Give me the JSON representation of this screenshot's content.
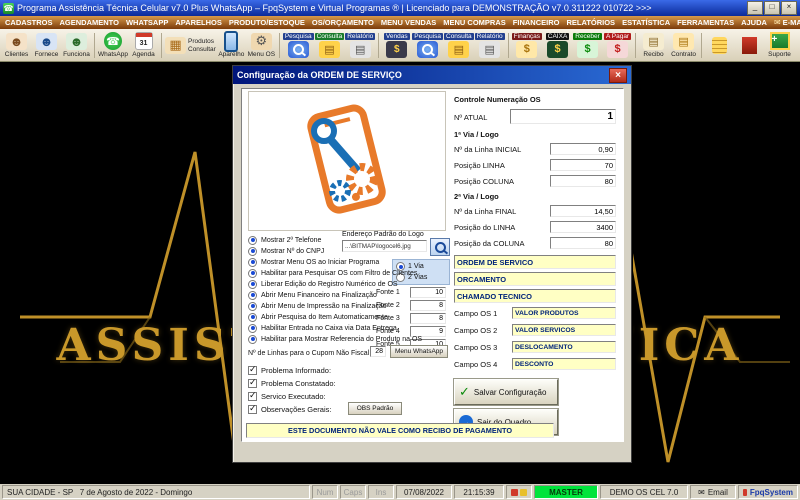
{
  "titlebar": {
    "title": "Programa Assistência Técnica Celular v7.0 Plus WhatsApp – FpqSystem e Virtual Programas ® | Licenciado para  DEMONSTRAÇÃO v7.0.311222 010722 >>>"
  },
  "menubar": {
    "items": [
      "CADASTROS",
      "AGENDAMENTO",
      "WHATSAPP",
      "APARELHOS",
      "PRODUTO/ESTOQUE",
      "OS/ORÇAMENTO",
      "MENU VENDAS",
      "MENU COMPRAS",
      "FINANCEIRO",
      "RELATÓRIOS",
      "ESTATÍSTICA",
      "FERRAMENTAS",
      "AJUDA",
      "E-MAIL"
    ]
  },
  "toolbar": {
    "items": [
      {
        "label": "Clientes"
      },
      {
        "label": "Fornece"
      },
      {
        "label": "Funciona"
      },
      {
        "label": "WhatsApp"
      },
      {
        "label": "Agenda"
      },
      {
        "label": "Produtos"
      },
      {
        "label": "Consultar"
      },
      {
        "label": "Aparelho"
      },
      {
        "label": "Menu OS"
      },
      {
        "label": "Pesquisa"
      },
      {
        "label": "Consulta"
      },
      {
        "label": "Relatório"
      },
      {
        "label": "Vendas"
      },
      {
        "label": "Pesquisa"
      },
      {
        "label": "Consulta"
      },
      {
        "label": "Relatório"
      },
      {
        "label": "Finanças"
      },
      {
        "label": "CAIXA"
      },
      {
        "label": "Receber"
      },
      {
        "label": "A Pagar"
      },
      {
        "label": "Recibo"
      },
      {
        "label": "Contrato"
      },
      {
        "label": "Suporte"
      }
    ]
  },
  "background": {
    "brand": "ASSISTÊNCIA TÉCNICA"
  },
  "dialog": {
    "title": "Configuração da ORDEM DE SERVIÇO",
    "numbering": {
      "header": "Controle Numeração OS",
      "atual_label": "Nº ATUAL",
      "atual_value": "1",
      "via1_header": "1ª Via / Logo",
      "via1": [
        {
          "label": "Nº da Linha INICIAL",
          "value": "0,90"
        },
        {
          "label": "Posição LINHA",
          "value": "70"
        },
        {
          "label": "Posição COLUNA",
          "value": "80"
        }
      ],
      "via2_header": "2ª Via / Logo",
      "via2": [
        {
          "label": "Nº da Linha FINAL",
          "value": "14,50"
        },
        {
          "label": "Posição do LINHA",
          "value": "3400"
        },
        {
          "label": "Posição da COLUNA",
          "value": "80"
        }
      ]
    },
    "doc_titles": [
      "ORDEM DE SERVICO",
      "ORCAMENTO",
      "CHAMADO TECNICO"
    ],
    "campos": [
      {
        "label": "Campo OS 1",
        "value": "VALOR PRODUTOS"
      },
      {
        "label": "Campo OS 2",
        "value": "VALOR SERVICOS"
      },
      {
        "label": "Campo OS 3",
        "value": "DESLOCAMENTO"
      },
      {
        "label": "Campo OS 4",
        "value": "DESCONTO"
      }
    ],
    "logo_addr": {
      "label": "Endereço Padrão do Logo",
      "value": "...\\BITMAP\\logocel6.jpg"
    },
    "vias": {
      "one": {
        "label": "1 Via",
        "on": true
      },
      "two": {
        "label": "2 Vias",
        "on": false
      }
    },
    "fontes": [
      {
        "label": "Fonte 1",
        "value": "10"
      },
      {
        "label": "Fonte 2",
        "value": "8"
      },
      {
        "label": "Fonte 3",
        "value": "8"
      },
      {
        "label": "Fonte 4",
        "value": "9"
      },
      {
        "label": "Fonte 5",
        "value": "10"
      }
    ],
    "options": [
      {
        "label": "Mostrar 2º Telefone",
        "on": true
      },
      {
        "label": "Mostrar Nº do CNPJ",
        "on": true
      },
      {
        "label": "Mostrar Menu OS ao Iniciar Programa",
        "on": true
      },
      {
        "label": "Habilitar para Pesquisar OS com Filtro de Clientes",
        "on": true
      },
      {
        "label": "Liberar Edição do Registro Numérico de OS",
        "on": true
      },
      {
        "label": "Abrir Menu Financeiro na Finalização",
        "on": true
      },
      {
        "label": "Abrir Menu de Impressão na Finalização",
        "on": true
      },
      {
        "label": "Abrir Pesquisa do Item Automaticamente",
        "on": true
      },
      {
        "label": "Habilitar Entrada no Caixa via Data Entrega",
        "on": true
      },
      {
        "label": "Habilitar para Mostrar Referencia do Produto na OS",
        "on": true
      }
    ],
    "cupom": {
      "label": "Nº de Linhas para o Cupom Não Fiscal",
      "value": "28",
      "button": "Menu WhatsApp"
    },
    "checks": [
      {
        "label": "Problema Informado:",
        "on": true
      },
      {
        "label": "Problema Constatado:",
        "on": true
      },
      {
        "label": "Servico Executado:",
        "on": true
      },
      {
        "label": "Observações Gerais:",
        "on": true
      }
    ],
    "obs_button": "OBS Padrão",
    "banner": "ESTE DOCUMENTO NÃO VALE COMO RECIBO DE PAGAMENTO",
    "save_button": "Salvar Configuração",
    "exit_button": "Sair do Quadro"
  },
  "statusbar": {
    "location": "SUA CIDADE - SP   7 de Agosto de 2022 - Domingo",
    "num": "Num",
    "caps": "Caps",
    "ins": "Ins",
    "date": "07/08/2022",
    "time": "21:15:39",
    "master": "MASTER",
    "demo": "DEMO OS CEL 7.0",
    "email": "Email",
    "brand": "FpqSystem"
  },
  "colors": {
    "accent_blue": "#1a4ad4",
    "gold": "#c9982a",
    "field_yellow": "#ffffc4",
    "master_green": "#00e43c",
    "title_blue": "#0a2a9a",
    "menubar_brown": "#7a3a0a"
  },
  "icons": {
    "email": "✉",
    "phone": "☎",
    "gear": "⚙",
    "check": "✓",
    "person": "☻",
    "crate": "▦",
    "doc": "▤",
    "dollar": "$",
    "plus": "+",
    "arrow": "→",
    "close": "×",
    "minimize": "_",
    "maximize": "□",
    "calendar_day": "31"
  }
}
